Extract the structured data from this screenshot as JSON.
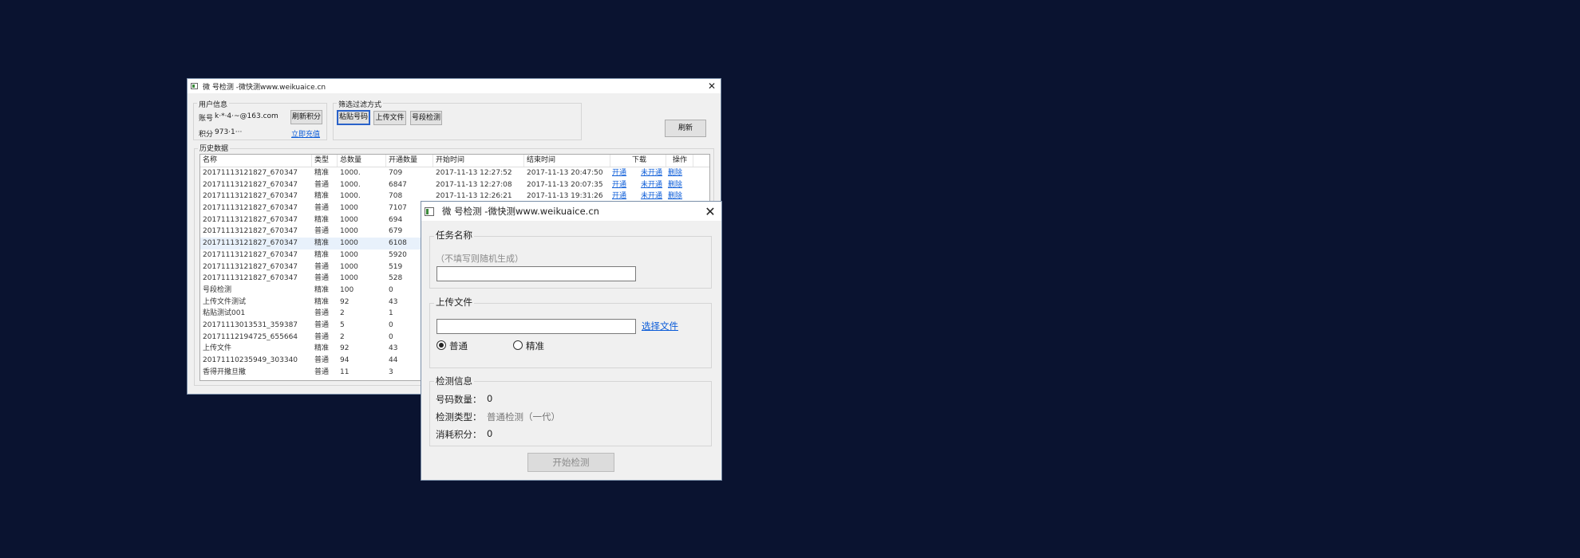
{
  "main": {
    "title": "微   号检测 -微快测www.weikuaice.cn",
    "close": "✕",
    "user_group": "用户信息",
    "account_label": "账号",
    "account_value": "k·*·4·~@163.com",
    "points_label": "积分",
    "points_value": "973·1···",
    "refresh_points_btn": "刷新积分",
    "recharge_link": "立即充值",
    "filter_group": "筛选过滤方式",
    "paste_btn": "粘贴号码",
    "upload_btn": "上传文件",
    "segment_btn": "号段检测",
    "refresh_btn": "刷新",
    "history_group": "历史数据",
    "columns": [
      "名称",
      "类型",
      "总数量",
      "开通数量",
      "开始时间",
      "结束时间",
      "下载",
      "操作"
    ],
    "rows": [
      {
        "name": "20171113121827_670347",
        "type": "精准",
        "total": "1000.",
        "open": "709",
        "start": "2017-11-13 12:27:52",
        "end": "2017-11-13 20:47:50",
        "dl_open": "开通",
        "dl_unopen": "未开通",
        "action": "删除"
      },
      {
        "name": "20171113121827_670347",
        "type": "普通",
        "total": "1000.",
        "open": "6847",
        "start": "2017-11-13 12:27:08",
        "end": "2017-11-13 20:07:35",
        "dl_open": "开通",
        "dl_unopen": "未开通",
        "action": "删除"
      },
      {
        "name": "20171113121827_670347",
        "type": "精准",
        "total": "1000.",
        "open": "708",
        "start": "2017-11-13 12:26:21",
        "end": "2017-11-13 19:31:26",
        "dl_open": "开通",
        "dl_unopen": "未开通",
        "action": "删除"
      },
      {
        "name": "20171113121827_670347",
        "type": "普通",
        "total": "1000",
        "open": "7107",
        "start": "",
        "end": "",
        "dl_open": "",
        "dl_unopen": "",
        "action": ""
      },
      {
        "name": "20171113121827_670347",
        "type": "精准",
        "total": "1000",
        "open": "694",
        "start": "",
        "end": "",
        "dl_open": "",
        "dl_unopen": "",
        "action": ""
      },
      {
        "name": "20171113121827_670347",
        "type": "普通",
        "total": "1000",
        "open": "679",
        "start": "",
        "end": "",
        "dl_open": "",
        "dl_unopen": "",
        "action": ""
      },
      {
        "name": "20171113121827_670347",
        "type": "精准",
        "total": "1000",
        "open": "6108",
        "start": "",
        "end": "",
        "dl_open": "",
        "dl_unopen": "",
        "action": ""
      },
      {
        "name": "20171113121827_670347",
        "type": "精准",
        "total": "1000",
        "open": "5920",
        "start": "",
        "end": "",
        "dl_open": "",
        "dl_unopen": "",
        "action": ""
      },
      {
        "name": "20171113121827_670347",
        "type": "普通",
        "total": "1000",
        "open": "519",
        "start": "",
        "end": "",
        "dl_open": "",
        "dl_unopen": "",
        "action": ""
      },
      {
        "name": "20171113121827_670347",
        "type": "普通",
        "total": "1000",
        "open": "528",
        "start": "",
        "end": "",
        "dl_open": "",
        "dl_unopen": "",
        "action": ""
      },
      {
        "name": "号段检测",
        "type": "精准",
        "total": "100",
        "open": "0",
        "start": "",
        "end": "",
        "dl_open": "",
        "dl_unopen": "",
        "action": ""
      },
      {
        "name": "上传文件测试",
        "type": "精准",
        "total": "92",
        "open": "43",
        "start": "",
        "end": "",
        "dl_open": "",
        "dl_unopen": "",
        "action": ""
      },
      {
        "name": "粘贴测试001",
        "type": "普通",
        "total": "2",
        "open": "1",
        "start": "",
        "end": "",
        "dl_open": "",
        "dl_unopen": "",
        "action": ""
      },
      {
        "name": "20171113013531_359387",
        "type": "普通",
        "total": "5",
        "open": "0",
        "start": "",
        "end": "",
        "dl_open": "",
        "dl_unopen": "",
        "action": ""
      },
      {
        "name": "20171112194725_655664",
        "type": "普通",
        "total": "2",
        "open": "0",
        "start": "",
        "end": "",
        "dl_open": "",
        "dl_unopen": "",
        "action": ""
      },
      {
        "name": "上传文件",
        "type": "精准",
        "total": "92",
        "open": "43",
        "start": "",
        "end": "",
        "dl_open": "",
        "dl_unopen": "",
        "action": ""
      },
      {
        "name": "20171110235949_303340",
        "type": "普通",
        "total": "94",
        "open": "44",
        "start": "",
        "end": "",
        "dl_open": "",
        "dl_unopen": "",
        "action": ""
      },
      {
        "name": "香得开撒旦撒",
        "type": "普通",
        "total": "11",
        "open": "3",
        "start": "",
        "end": "",
        "dl_open": "",
        "dl_unopen": "",
        "action": ""
      }
    ],
    "selected_row": 6
  },
  "dialog": {
    "title": "微   号检测 -微快测www.weikuaice.cn",
    "close": "✕",
    "task_group": "任务名称",
    "task_hint": "（不填写则随机生成）",
    "task_value": "",
    "upload_group": "上传文件",
    "file_value": "",
    "choose_file_link": "选择文件",
    "radio_normal": "普通",
    "radio_precise": "精准",
    "radio_selected": "普通",
    "info_group": "检测信息",
    "count_label": "号码数量：",
    "count_value": "0",
    "type_label": "检测类型：",
    "type_value": "普通检测（一代）",
    "cost_label": "消耗积分：",
    "cost_value": "0",
    "start_btn": "开始检测"
  }
}
